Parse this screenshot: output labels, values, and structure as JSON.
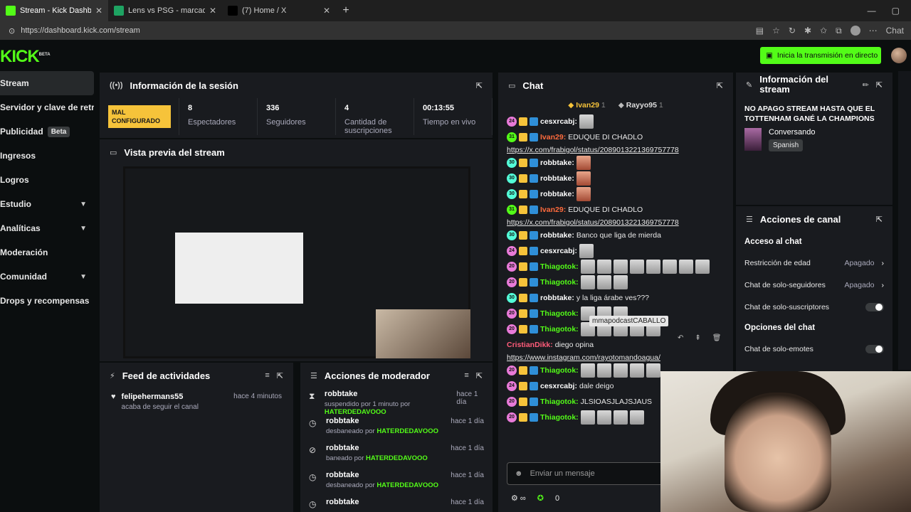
{
  "browser": {
    "tabs": [
      {
        "title": "Stream - Kick Dashboard",
        "color": "#53fc18"
      },
      {
        "title": "Lens vs PSG - marcador en vivo, alineaciones",
        "color": "#1ea362"
      },
      {
        "title": "(7) Home / X",
        "color": "#000000"
      }
    ],
    "url": "https://dashboard.kick.com/stream",
    "chat_label": "Chat"
  },
  "header": {
    "logo": "KICK",
    "logo_badge": "BETA",
    "go_live_label": "Inicia la transmisión en directo"
  },
  "sidebar": {
    "items": [
      {
        "label": "Stream",
        "active": true
      },
      {
        "label": "Servidor y clave de retransmisión"
      },
      {
        "label": "Publicidad",
        "badge": "Beta"
      },
      {
        "label": "Ingresos"
      },
      {
        "label": "Logros"
      },
      {
        "label": "Estudio",
        "expand": true
      },
      {
        "label": "Analíticas",
        "expand": true
      },
      {
        "label": "Moderación"
      },
      {
        "label": "Comunidad",
        "expand": true
      },
      {
        "label": "Drops y recompensas"
      }
    ]
  },
  "session": {
    "title": "Información de la sesión",
    "status_badge": "MAL CONFIGURADO",
    "stats": [
      {
        "value": "8",
        "label": "Espectadores"
      },
      {
        "value": "336",
        "label": "Seguidores"
      },
      {
        "value": "4",
        "label": "Cantidad de suscripciones"
      },
      {
        "value": "00:13:55",
        "label": "Tiempo en vivo"
      }
    ]
  },
  "preview": {
    "title": "Vista previa del stream"
  },
  "feed": {
    "title": "Feed de actividades",
    "items": [
      {
        "user": "felipehermans55",
        "text": "acaba de seguir el canal",
        "time": "hace 4 minutos"
      }
    ]
  },
  "modactions": {
    "title": "Acciones de moderador",
    "items": [
      {
        "icon": "hourglass-icon",
        "glyph": "⧗",
        "user": "robbtake",
        "action": "suspendido por 1 minuto por",
        "by": "HATERDEDAVOOO",
        "time": "hace 1 día"
      },
      {
        "icon": "clock-icon",
        "glyph": "◷",
        "user": "robbtake",
        "action": "desbaneado por",
        "by": "HATERDEDAVOOO",
        "time": "hace 1 día"
      },
      {
        "icon": "ban-icon",
        "glyph": "⊘",
        "user": "robbtake",
        "action": "baneado por",
        "by": "HATERDEDAVOOO",
        "time": "hace 1 día"
      },
      {
        "icon": "clock-icon",
        "glyph": "◷",
        "user": "robbtake",
        "action": "desbaneado por",
        "by": "HATERDEDAVOOO",
        "time": "hace 1 día"
      },
      {
        "icon": "clock-icon",
        "glyph": "◷",
        "user": "robbtake",
        "action": "",
        "by": "",
        "time": "hace 1 día"
      }
    ]
  },
  "chat": {
    "title": "Chat",
    "top_users": [
      {
        "name": "Ivan29",
        "rank": "1"
      },
      {
        "name": "Rayyo95",
        "rank": "1"
      }
    ],
    "messages": [
      {
        "lvl": "24",
        "lc": "#e87ad8",
        "user": "cesxrcabj",
        "uc": "#ffffff",
        "text": "",
        "emotes": 1
      },
      {
        "lvl": "31",
        "lc": "#53fc18",
        "user": "Ivan29",
        "uc": "#ff6b3d",
        "text": "EDUQUE DI CHADLO",
        "link": "https://x.com/frabigol/status/2089013221369757778"
      },
      {
        "lvl": "30",
        "lc": "#53fcd8",
        "user": "robbtake",
        "uc": "#ffffff",
        "text": "",
        "emotes": 1,
        "red": true
      },
      {
        "lvl": "30",
        "lc": "#53fcd8",
        "user": "robbtake",
        "uc": "#ffffff",
        "text": "",
        "emotes": 1,
        "red": true
      },
      {
        "lvl": "30",
        "lc": "#53fcd8",
        "user": "robbtake",
        "uc": "#ffffff",
        "text": "",
        "emotes": 1,
        "red": true
      },
      {
        "lvl": "31",
        "lc": "#53fc18",
        "user": "Ivan29",
        "uc": "#ff6b3d",
        "text": "EDUQUE DI CHADLO",
        "link": "https://x.com/frabigol/status/2089013221369757778"
      },
      {
        "lvl": "30",
        "lc": "#53fcd8",
        "user": "robbtake",
        "uc": "#ffffff",
        "text": "Banco que liga de mierda"
      },
      {
        "lvl": "24",
        "lc": "#e87ad8",
        "user": "cesxrcabj",
        "uc": "#ffffff",
        "text": "",
        "emotes": 1
      },
      {
        "lvl": "20",
        "lc": "#e87ad8",
        "user": "Thiagotok",
        "uc": "#53fc18",
        "text": "",
        "emotes": 8
      },
      {
        "lvl": "20",
        "lc": "#e87ad8",
        "user": "Thiagotok",
        "uc": "#53fc18",
        "text": "",
        "emotes": 3
      },
      {
        "lvl": "30",
        "lc": "#53fcd8",
        "user": "robbtake",
        "uc": "#ffffff",
        "text": "y la liga árabe ves???"
      },
      {
        "lvl": "20",
        "lc": "#e87ad8",
        "user": "Thiagotok",
        "uc": "#53fc18",
        "text": "",
        "emotes": 3
      },
      {
        "lvl": "20",
        "lc": "#e87ad8",
        "user": "Thiagotok",
        "uc": "#53fc18",
        "text": "",
        "emotes": 5
      },
      {
        "lvl": "",
        "lc": "",
        "user": "CristianDikk",
        "uc": "#ff5c7a",
        "text": "diego opina",
        "link": "https://www.instagram.com/rayotomandoagua/"
      },
      {
        "lvl": "20",
        "lc": "#e87ad8",
        "user": "Thiagotok",
        "uc": "#53fc18",
        "text": "",
        "emotes": 5
      },
      {
        "lvl": "24",
        "lc": "#e87ad8",
        "user": "cesxrcabj",
        "uc": "#ffffff",
        "text": "dale deigo"
      },
      {
        "lvl": "20",
        "lc": "#e87ad8",
        "user": "Thiagotok",
        "uc": "#53fc18",
        "text": "JLSIOASJLAJSJAUS"
      },
      {
        "lvl": "20",
        "lc": "#e87ad8",
        "user": "Thiagotok",
        "uc": "#53fc18",
        "text": "",
        "emotes": 4
      }
    ],
    "tooltip": "mmapodcastCABALLO",
    "input_placeholder": "Enviar un mensaje",
    "footer_count": "0"
  },
  "streaminfo": {
    "title": "Información del stream",
    "stream_title": "NO APAGO STREAM HASTA QUE EL TOTTENHAM GANÉ LA CHAMPIONS",
    "category": "Conversando",
    "language": "Spanish"
  },
  "channel": {
    "title": "Acciones de canal",
    "chat_access": "Acceso al chat",
    "options": [
      {
        "label": "Restricción de edad",
        "value": "Apagado",
        "type": "select"
      },
      {
        "label": "Chat de solo-seguidores",
        "value": "Apagado",
        "type": "select"
      },
      {
        "label": "Chat de solo-suscriptores",
        "type": "toggle"
      }
    ],
    "chat_options": "Opciones del chat",
    "options2": [
      {
        "label": "Chat de solo-emotes",
        "type": "toggle"
      }
    ]
  }
}
